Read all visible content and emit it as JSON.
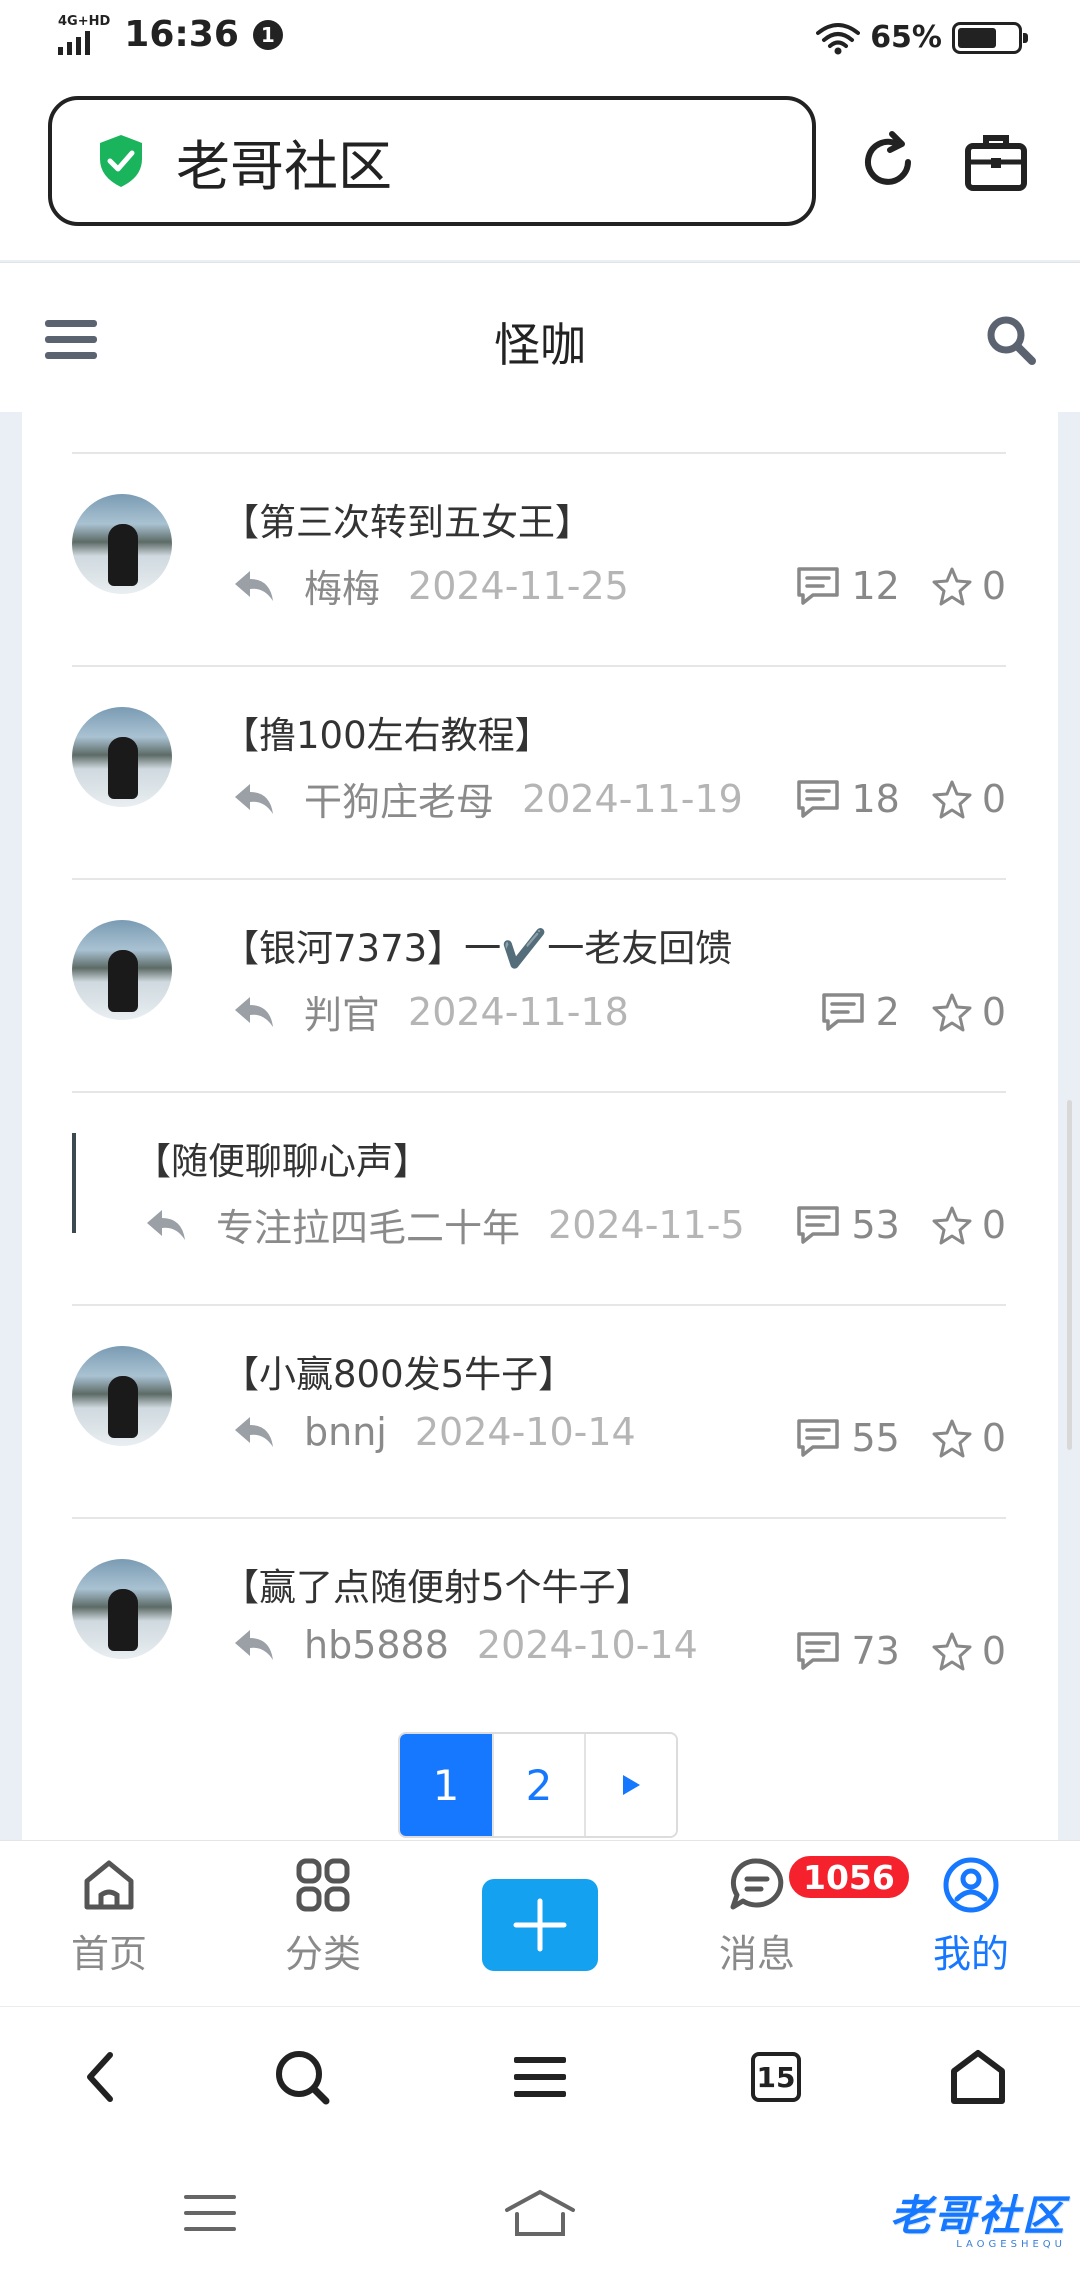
{
  "status_bar": {
    "network": "4G+HD",
    "time": "16:36",
    "notification_count": "1",
    "battery_percent": "65%",
    "battery_level": 0.65
  },
  "browser": {
    "url_text": "老哥社区",
    "refresh_icon": "refresh-icon",
    "toolbox_icon": "toolbox-icon"
  },
  "header": {
    "title": "怪咖",
    "menu_icon": "menu-icon",
    "search_icon": "search-icon"
  },
  "posts": [
    {
      "title": "【第三次转到五女王】",
      "author": "梅梅",
      "date": "2024-11-25",
      "comments": "12",
      "stars": "0"
    },
    {
      "title": "【撸100左右教程】",
      "author": "干狗庄老母",
      "date": "2024-11-19",
      "comments": "18",
      "stars": "0"
    },
    {
      "title": "【银河7373】一✔️一老友回馈",
      "author": "判官",
      "date": "2024-11-18",
      "comments": "2",
      "stars": "0"
    },
    {
      "title": "【随便聊聊心声】",
      "author": "专注拉四毛二十年",
      "date": "2024-11-5",
      "comments": "53",
      "stars": "0"
    },
    {
      "title": "【小赢800发5牛子】",
      "author": "bnnj",
      "date": "2024-10-14",
      "comments": "55",
      "stars": "0"
    },
    {
      "title": "【赢了点随便射5个牛子】",
      "author": "hb5888",
      "date": "2024-10-14",
      "comments": "73",
      "stars": "0"
    }
  ],
  "pagination": {
    "pages": [
      "1",
      "2"
    ],
    "current": "1",
    "next_icon": "play-arrow-icon"
  },
  "tabbar": {
    "home": "首页",
    "category": "分类",
    "messages": "消息",
    "mine": "我的",
    "messages_badge": "1056",
    "active_color": "#1677ff",
    "plus_color": "#14a1f0"
  },
  "browser_nav": {
    "tabs_count": "15"
  },
  "watermark": {
    "text": "老哥社区",
    "sub": "LAOGESHEQU"
  }
}
